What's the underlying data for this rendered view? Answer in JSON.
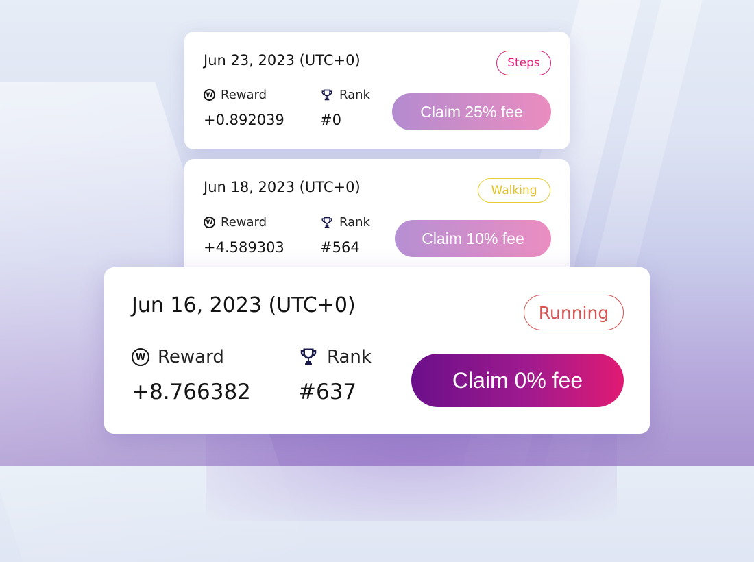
{
  "cards": [
    {
      "date": "Jun 23, 2023 (UTC+0)",
      "tag": "Steps",
      "reward_label": "Reward",
      "reward_value": "+0.892039",
      "rank_label": "Rank",
      "rank_value": "#0",
      "claim_label": "Claim 25% fee"
    },
    {
      "date": "Jun 18, 2023 (UTC+0)",
      "tag": "Walking",
      "reward_label": "Reward",
      "reward_value": "+4.589303",
      "rank_label": "Rank",
      "rank_value": "#564",
      "claim_label": "Claim 10% fee"
    },
    {
      "date": "Jun 16, 2023 (UTC+0)",
      "tag": "Running",
      "reward_label": "Reward",
      "reward_value": "+8.766382",
      "rank_label": "Rank",
      "rank_value": "#637",
      "claim_label": "Claim 0% fee"
    }
  ],
  "icons": {
    "reward": "w-coin-icon",
    "rank": "trophy-icon"
  },
  "colors": {
    "steps_tag": "#e0207c",
    "walking_tag": "#e3c125",
    "running_tag": "#d65454",
    "claim_primary_start": "#6a0f8a",
    "claim_primary_end": "#e01a73",
    "claim_muted_start": "#b48bd0",
    "claim_muted_end": "#ea8cbf"
  }
}
